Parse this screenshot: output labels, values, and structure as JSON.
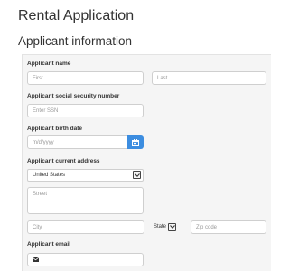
{
  "header": {
    "title": "Rental Application",
    "section_title": "Applicant information"
  },
  "form": {
    "name": {
      "label": "Applicant name",
      "first_placeholder": "First",
      "last_placeholder": "Last"
    },
    "ssn": {
      "label": "Applicant social security number",
      "placeholder": "Enter SSN"
    },
    "birth_date": {
      "label": "Applicant birth date",
      "placeholder": "m/d/yyyy"
    },
    "address": {
      "label": "Applicant current address",
      "country_value": "United States",
      "street_placeholder": "Street",
      "city_placeholder": "City",
      "state_label": "State",
      "zip_placeholder": "Zip code"
    },
    "email": {
      "label": "Applicant email"
    }
  },
  "colors": {
    "accent": "#3c8de0",
    "panel_bg": "#f5f5f5"
  },
  "icons": {
    "calendar": "calendar-icon",
    "email": "envelope-icon",
    "dropdown": "chevron-down-icon"
  }
}
